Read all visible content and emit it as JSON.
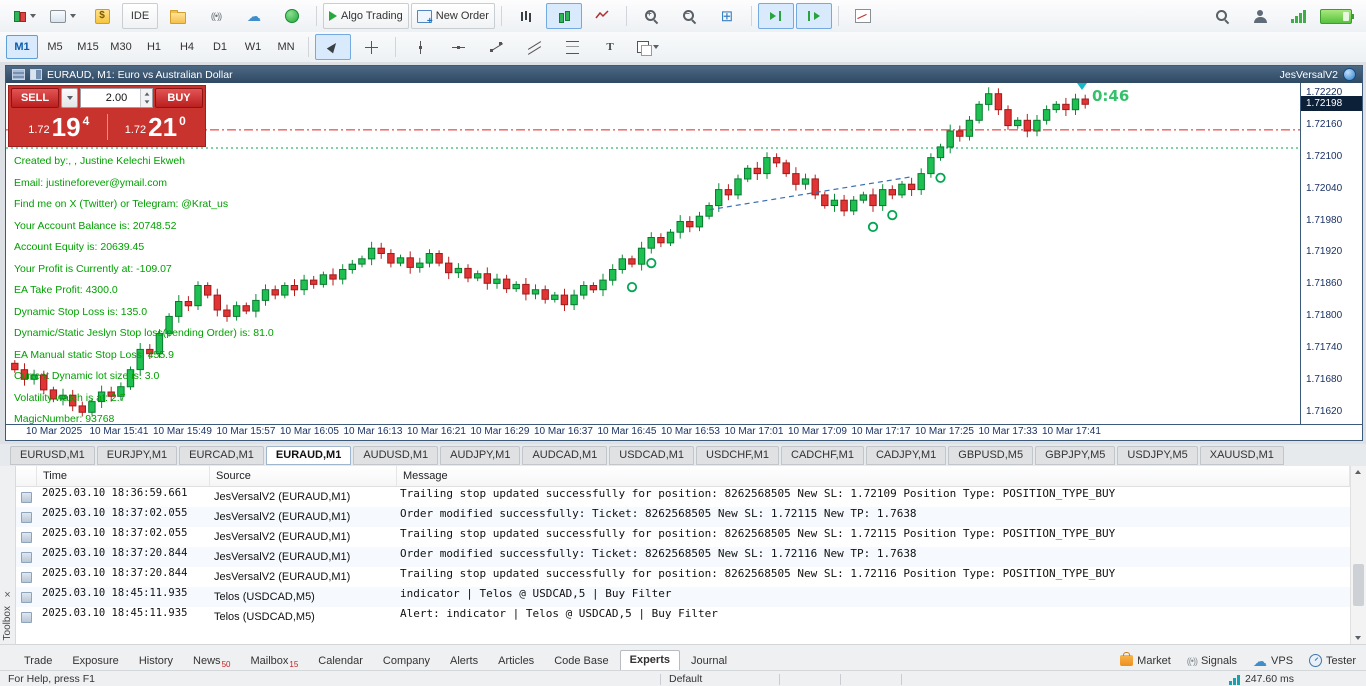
{
  "toolbar": {
    "ide_label": "IDE",
    "algo_trading_label": "Algo Trading",
    "new_order_label": "New Order"
  },
  "timeframes": {
    "items": [
      "M1",
      "M5",
      "M15",
      "M30",
      "H1",
      "H4",
      "D1",
      "W1",
      "MN"
    ],
    "active": "M1"
  },
  "chart": {
    "title": "EURAUD, M1: Euro vs Australian Dollar",
    "ea_name": "JesVersalV2",
    "candle_timer": "0:46",
    "current_price": "1.72198",
    "one_click": {
      "sell_label": "SELL",
      "buy_label": "BUY",
      "lot": "2.00",
      "sell_price": {
        "base": "1.72",
        "big": "19",
        "pip": "4"
      },
      "buy_price": {
        "base": "1.72",
        "big": "21",
        "pip": "0"
      }
    },
    "info_lines": [
      "Created by:, ,  Justine Kelechi Ekweh",
      "Email:  justineforever@ymail.com",
      "Find me on X (Twitter) or Telegram:  @Krat_us",
      "Your Account Balance is: 20748.52",
      "Account Equity is: 20639.45",
      "Your Profit is Currently at: -109.07",
      "EA Take Profit: 4300.0",
      "Dynamic Stop Loss is:  135.0",
      "Dynamic/Static Jeslyn Stop loss(pending Order)  is: 81.0",
      "EA Manual static Stop Loss: 455.9",
      "Current Dynamic lot size is: 3.0",
      "Volatility watch is at: 2.7",
      "MagicNumber: 93768"
    ],
    "price_labels": [
      "1.72220",
      "1.72160",
      "1.72100",
      "1.72040",
      "1.71980",
      "1.71920",
      "1.71860",
      "1.71800",
      "1.71740",
      "1.71680",
      "1.71620"
    ],
    "time_labels": [
      "10 Mar 2025",
      "10 Mar 15:41",
      "10 Mar 15:49",
      "10 Mar 15:57",
      "10 Mar 16:05",
      "10 Mar 16:13",
      "10 Mar 16:21",
      "10 Mar 16:29",
      "10 Mar 16:37",
      "10 Mar 16:45",
      "10 Mar 16:53",
      "10 Mar 17:01",
      "10 Mar 17:09",
      "10 Mar 17:17",
      "10 Mar 17:25",
      "10 Mar 17:33",
      "10 Mar 17:41"
    ]
  },
  "chart_data": {
    "type": "candlestick",
    "symbol": "EURAUD",
    "timeframe": "M1",
    "scale": {
      "max": 1.72238,
      "min": 1.71598
    },
    "first_open": 1.71712,
    "wick": 6e-05,
    "closes": [
      1.717,
      1.71682,
      1.7169,
      1.71662,
      1.71645,
      1.71652,
      1.71632,
      1.7162,
      1.7164,
      1.71658,
      1.7165,
      1.71668,
      1.717,
      1.71738,
      1.7173,
      1.71768,
      1.718,
      1.71828,
      1.7182,
      1.71858,
      1.7184,
      1.71812,
      1.718,
      1.7182,
      1.7181,
      1.7183,
      1.7185,
      1.7184,
      1.71858,
      1.7185,
      1.71868,
      1.7186,
      1.71878,
      1.7187,
      1.71888,
      1.71898,
      1.71908,
      1.71928,
      1.71918,
      1.719,
      1.7191,
      1.71892,
      1.719,
      1.71918,
      1.719,
      1.71882,
      1.7189,
      1.71872,
      1.7188,
      1.71862,
      1.7187,
      1.71852,
      1.7186,
      1.71842,
      1.7185,
      1.71832,
      1.7184,
      1.71822,
      1.7184,
      1.71858,
      1.7185,
      1.71868,
      1.71888,
      1.71908,
      1.71898,
      1.71928,
      1.71948,
      1.71938,
      1.71958,
      1.71978,
      1.71968,
      1.71988,
      1.72008,
      1.72038,
      1.72028,
      1.72058,
      1.72078,
      1.72068,
      1.72098,
      1.72088,
      1.72068,
      1.72048,
      1.72058,
      1.72028,
      1.72008,
      1.72018,
      1.71998,
      1.72018,
      1.72028,
      1.72008,
      1.72038,
      1.72028,
      1.72048,
      1.72038,
      1.72068,
      1.72098,
      1.72118,
      1.72148,
      1.72138,
      1.72168,
      1.72198,
      1.72218,
      1.72188,
      1.72158,
      1.72168,
      1.72148,
      1.72168,
      1.72188,
      1.72198,
      1.72188,
      1.72208,
      1.72198
    ],
    "levels": [
      {
        "name": "stop-level-line",
        "price": 1.7215,
        "color": "#e02020",
        "style": "dashdot"
      },
      {
        "name": "trailing-sl-line",
        "price": 1.72116,
        "color": "#00a651",
        "style": "dot"
      }
    ],
    "trendline": {
      "from": {
        "i": 72,
        "price": 1.72
      },
      "to": {
        "i": 93,
        "price": 1.72062
      }
    },
    "markers": [
      {
        "i": 64,
        "price": 1.71855
      },
      {
        "i": 66,
        "price": 1.719
      },
      {
        "i": 89,
        "price": 1.71968
      },
      {
        "i": 91,
        "price": 1.7199
      },
      {
        "i": 96,
        "price": 1.7206
      }
    ]
  },
  "chart_tabs": {
    "items": [
      "EURUSD,M1",
      "EURJPY,M1",
      "EURCAD,M1",
      "EURAUD,M1",
      "AUDUSD,M1",
      "AUDJPY,M1",
      "AUDCAD,M1",
      "USDCAD,M1",
      "USDCHF,M1",
      "CADCHF,M1",
      "CADJPY,M1",
      "GBPUSD,M5",
      "GBPJPY,M5",
      "USDJPY,M5",
      "XAUUSD,M1"
    ],
    "active": "EURAUD,M1"
  },
  "toolbox": {
    "caption": "Toolbox",
    "columns": [
      "Time",
      "Source",
      "Message"
    ],
    "rows": [
      {
        "time": "2025.03.10 18:36:59.661",
        "source": "JesVersalV2 (EURAUD,M1)",
        "message": "Trailing stop updated successfully for position: 8262568505 New SL: 1.72109 Position Type: POSITION_TYPE_BUY"
      },
      {
        "time": "2025.03.10 18:37:02.055",
        "source": "JesVersalV2 (EURAUD,M1)",
        "message": "Order modified successfully: Ticket: 8262568505 New SL: 1.72115 New TP: 1.7638"
      },
      {
        "time": "2025.03.10 18:37:02.055",
        "source": "JesVersalV2 (EURAUD,M1)",
        "message": "Trailing stop updated successfully for position: 8262568505 New SL: 1.72115 Position Type: POSITION_TYPE_BUY"
      },
      {
        "time": "2025.03.10 18:37:20.844",
        "source": "JesVersalV2 (EURAUD,M1)",
        "message": "Order modified successfully: Ticket: 8262568505 New SL: 1.72116 New TP: 1.7638"
      },
      {
        "time": "2025.03.10 18:37:20.844",
        "source": "JesVersalV2 (EURAUD,M1)",
        "message": "Trailing stop updated successfully for position: 8262568505 New SL: 1.72116 Position Type: POSITION_TYPE_BUY"
      },
      {
        "time": "2025.03.10 18:45:11.935",
        "source": "Telos (USDCAD,M5)",
        "message": "indicator | Telos @ USDCAD,5 | Buy Filter"
      },
      {
        "time": "2025.03.10 18:45:11.935",
        "source": "Telos (USDCAD,M5)",
        "message": "Alert: indicator | Telos @ USDCAD,5 | Buy Filter"
      }
    ]
  },
  "bottom_tabs": {
    "items": [
      {
        "label": "Trade"
      },
      {
        "label": "Exposure"
      },
      {
        "label": "History"
      },
      {
        "label": "News",
        "badge": "50"
      },
      {
        "label": "Mailbox",
        "badge": "15"
      },
      {
        "label": "Calendar"
      },
      {
        "label": "Company"
      },
      {
        "label": "Alerts"
      },
      {
        "label": "Articles"
      },
      {
        "label": "Code Base"
      },
      {
        "label": "Experts"
      },
      {
        "label": "Journal"
      }
    ],
    "active": "Experts",
    "right": [
      {
        "label": "Market"
      },
      {
        "label": "Signals"
      },
      {
        "label": "VPS"
      },
      {
        "label": "Tester"
      }
    ]
  },
  "status_bar": {
    "help": "For Help, press F1",
    "profile": "Default",
    "latency": "247.60 ms"
  }
}
